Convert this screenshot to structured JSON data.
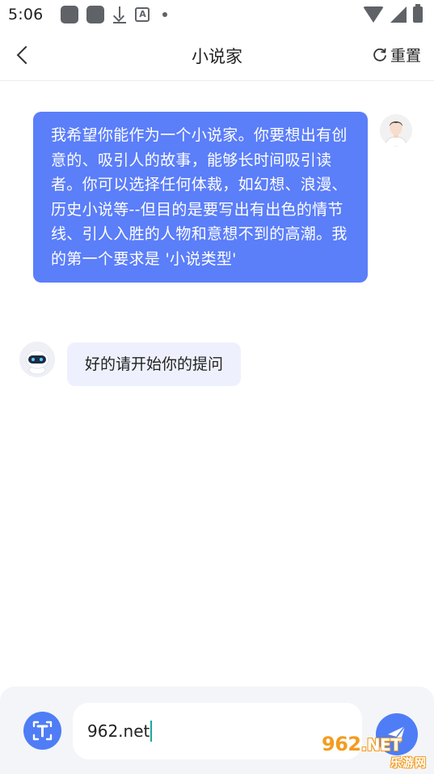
{
  "status_bar": {
    "time": "5:06",
    "notification_icons": [
      "app-icon",
      "app-icon",
      "download-icon",
      "a-box-icon",
      "dot-icon"
    ],
    "system_icons": [
      "wifi-icon",
      "signal-icon",
      "battery-icon"
    ]
  },
  "header": {
    "title": "小说家",
    "reset_label": "重置"
  },
  "chat": {
    "messages": [
      {
        "role": "user",
        "text": "我希望你能作为一个小说家。你要想出有创意的、吸引人的故事，能够长时间吸引读者。你可以选择任何体裁，如幻想、浪漫、历史小说等--但目的是要写出有出色的情节线、引人入胜的人物和意想不到的高潮。我的第一个要求是 '小说类型'"
      },
      {
        "role": "assistant",
        "text": "好的请开始你的提问"
      }
    ]
  },
  "composer": {
    "input_value": "962.net"
  },
  "watermark": {
    "brand_number": "962",
    "brand_suffix": ".NET",
    "tagline": "乐游网"
  },
  "colors": {
    "accent": "#5b7ef9",
    "bot_bubble": "#eef1fd",
    "input_bar": "#f4f5f8",
    "watermark": "#f39c1f"
  }
}
